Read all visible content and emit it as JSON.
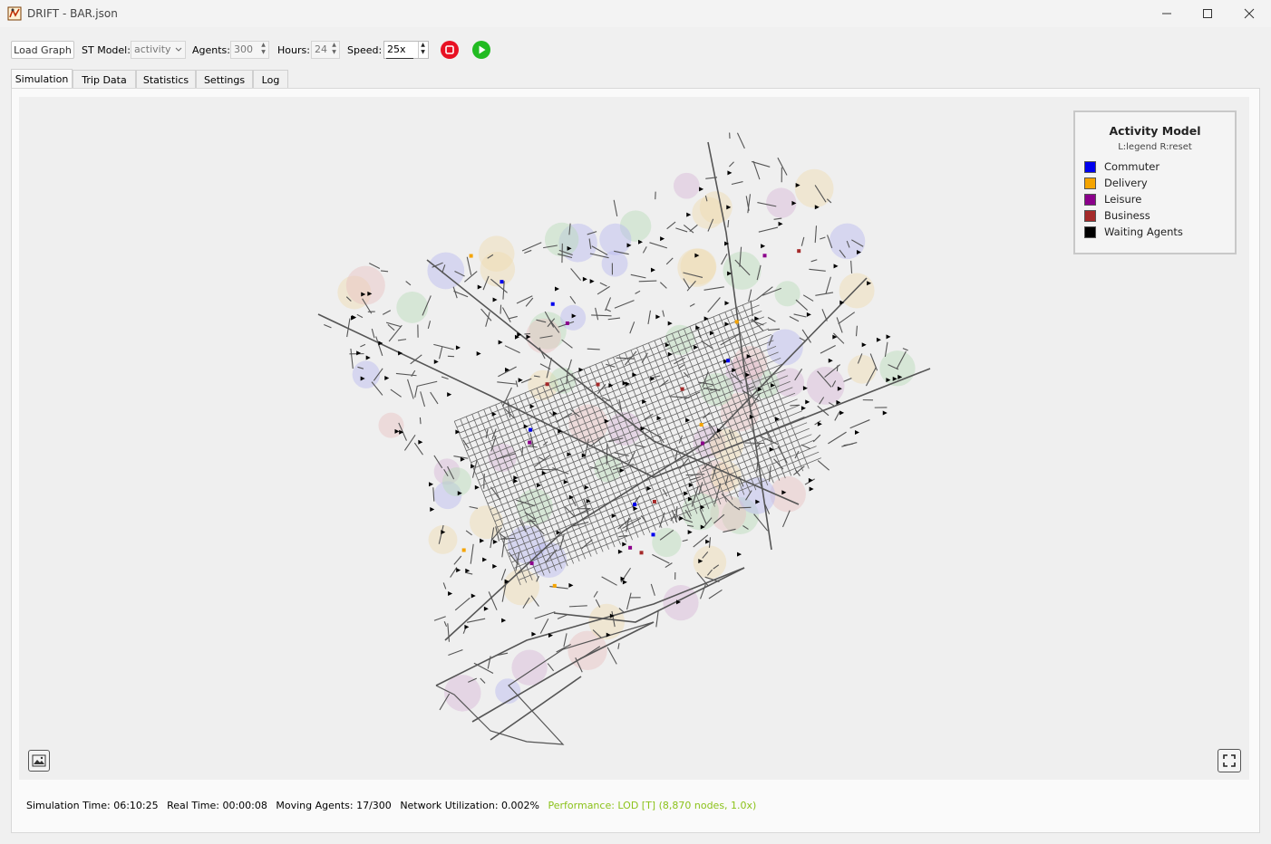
{
  "window": {
    "title": "DRIFT - BAR.json"
  },
  "toolbar": {
    "load_graph_label": "Load Graph",
    "st_model_label": "ST Model:",
    "st_model_value": "activity",
    "agents_label": "Agents:",
    "agents_value": "300",
    "hours_label": "Hours:",
    "hours_value": "24",
    "speed_label": "Speed:",
    "speed_value": "25x"
  },
  "tabs": [
    {
      "label": "Simulation",
      "active": true
    },
    {
      "label": "Trip Data",
      "active": false
    },
    {
      "label": "Statistics",
      "active": false
    },
    {
      "label": "Settings",
      "active": false
    },
    {
      "label": "Log",
      "active": false
    }
  ],
  "legend": {
    "title": "Activity Model",
    "subtitle": "L:legend R:reset",
    "items": [
      {
        "label": "Commuter",
        "color": "#0000ee"
      },
      {
        "label": "Delivery",
        "color": "#f5a400"
      },
      {
        "label": "Leisure",
        "color": "#8b008b"
      },
      {
        "label": "Business",
        "color": "#a52a2a"
      },
      {
        "label": "Waiting Agents",
        "color": "#000000"
      }
    ]
  },
  "status": {
    "sim_time": "Simulation Time: 06:10:25",
    "real_time": "Real Time: 00:00:08",
    "moving_agents": "Moving Agents: 17/300",
    "network_util": "Network Utilization: 0.002%",
    "performance": "Performance: LOD [T] (8,870 nodes, 1.0x)"
  },
  "colors": {
    "stop_button": "#e81123",
    "play_button": "#22bb22",
    "performance_text": "#8cc21a",
    "road": "#555555"
  }
}
